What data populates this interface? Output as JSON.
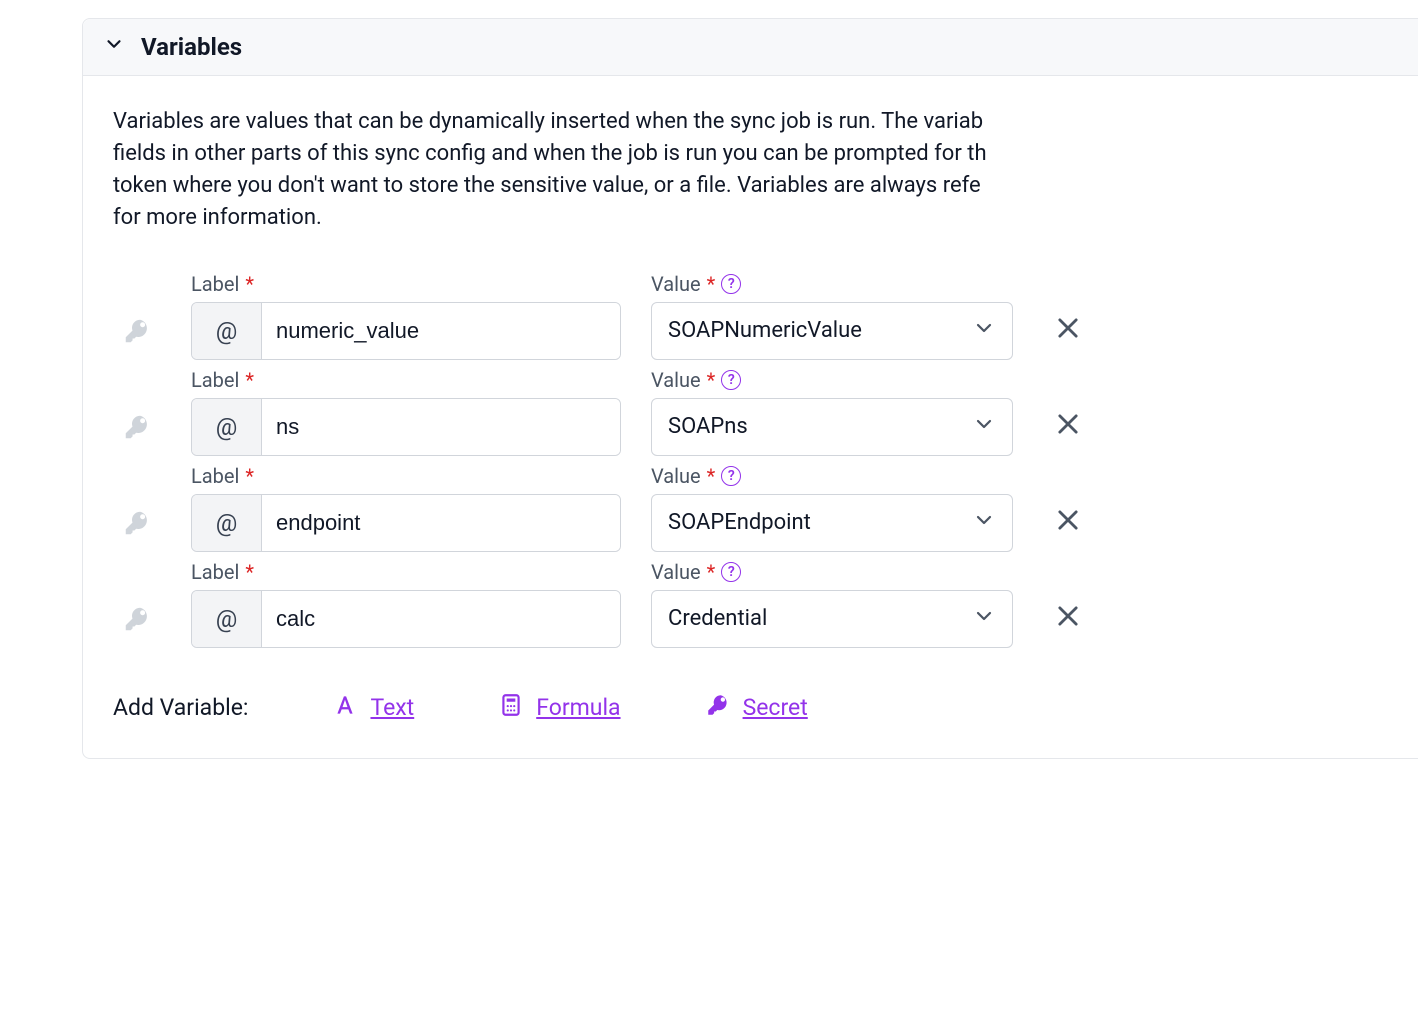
{
  "panel": {
    "title": "Variables",
    "description": "Variables are values that can be dynamically inserted when the sync job is run. The variab\nfields in other parts of this sync config and when the job is run you can be prompted for th\ntoken where you don't want to store the sensitive value, or a file. Variables are always refe\nfor more information."
  },
  "labels": {
    "label_field": "Label",
    "value_field": "Value",
    "required_mark": "*",
    "at_prefix": "@",
    "help_char": "?",
    "add_variable": "Add Variable:"
  },
  "rows": [
    {
      "label": "numeric_value",
      "value": "SOAPNumericValue"
    },
    {
      "label": "ns",
      "value": "SOAPns"
    },
    {
      "label": "endpoint",
      "value": "SOAPEndpoint"
    },
    {
      "label": "calc",
      "value": "Credential"
    }
  ],
  "add_links": {
    "text": "Text",
    "formula": "Formula",
    "secret": "Secret"
  }
}
